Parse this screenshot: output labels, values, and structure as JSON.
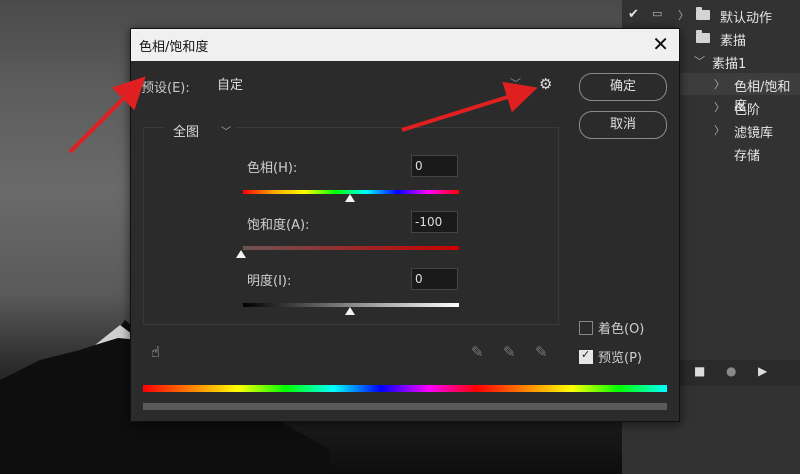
{
  "actions_panel": {
    "items": [
      {
        "label": "默认动作",
        "level": 0,
        "type": "set"
      },
      {
        "label": "素描",
        "level": 0,
        "type": "set"
      },
      {
        "label": "素描1",
        "level": 1,
        "type": "action"
      },
      {
        "label": "色相/饱和度",
        "level": 2,
        "type": "step"
      },
      {
        "label": "色阶",
        "level": 2,
        "type": "step"
      },
      {
        "label": "滤镜库",
        "level": 2,
        "type": "step"
      },
      {
        "label": "存储",
        "level": 2,
        "type": "step"
      }
    ]
  },
  "dialog": {
    "title": "色相/饱和度",
    "preset_label": "预设(E):",
    "preset_value": "自定",
    "ok_label": "确定",
    "cancel_label": "取消",
    "channel_value": "全图",
    "hue": {
      "label": "色相(H):",
      "value": "0",
      "level": 0
    },
    "saturation": {
      "label": "饱和度(A):",
      "value": "-100",
      "level": -100
    },
    "lightness": {
      "label": "明度(I):",
      "value": "0",
      "level": 0
    },
    "colorize_label": "着色(O)",
    "colorize_checked": false,
    "preview_label": "预览(P)",
    "preview_checked": true
  },
  "colors": {
    "annotation_arrow": "#e02020",
    "dialog_bg": "#2b2b2b",
    "panel_bg": "#323232"
  },
  "icons": [
    "checkmark-icon",
    "dialog-toggle-icon",
    "folder-icon",
    "chevron-right-icon",
    "chevron-down-icon",
    "gear-icon",
    "close-icon",
    "hand-adjust-icon",
    "eyedropper-icon",
    "eyedropper-plus-icon",
    "eyedropper-minus-icon",
    "stop-icon",
    "record-icon",
    "play-icon"
  ]
}
